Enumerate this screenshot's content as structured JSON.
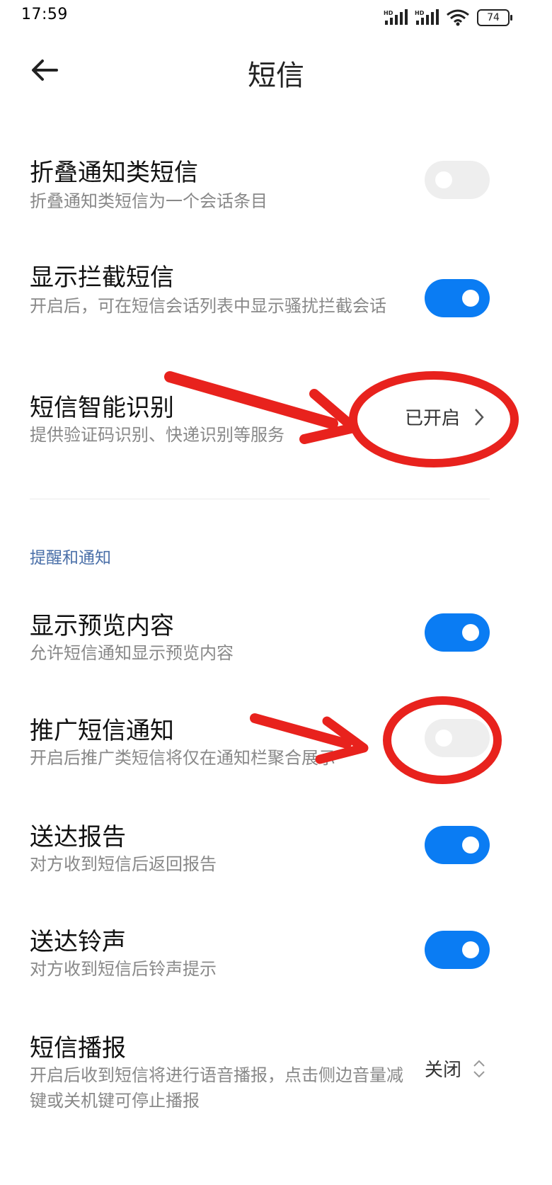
{
  "status": {
    "time": "17:59",
    "signal1": "HD",
    "signal2": "HD",
    "battery": "74"
  },
  "header": {
    "title": "短信"
  },
  "settings": [
    {
      "title": "折叠通知类短信",
      "subtitle": "折叠通知类短信为一个会话条目",
      "state": "off"
    },
    {
      "title": "显示拦截短信",
      "subtitle": "开启后，可在短信会话列表中显示骚扰拦截会话",
      "state": "on"
    },
    {
      "title": "短信智能识别",
      "subtitle": "提供验证码识别、快递识别等服务",
      "value": "已开启"
    }
  ],
  "section": {
    "label": "提醒和通知"
  },
  "notifications": [
    {
      "title": "显示预览内容",
      "subtitle": "允许短信通知显示预览内容",
      "state": "on"
    },
    {
      "title": "推广短信通知",
      "subtitle": "开启后推广类短信将仅在通知栏聚合展示",
      "state": "off"
    },
    {
      "title": "送达报告",
      "subtitle": "对方收到短信后返回报告",
      "state": "on"
    },
    {
      "title": "送达铃声",
      "subtitle": "对方收到短信后铃声提示",
      "state": "on"
    },
    {
      "title": "短信播报",
      "subtitle": "开启后收到短信将进行语音播报，点击侧边音量减键或关机键可停止播报",
      "value": "关闭"
    }
  ],
  "colors": {
    "accent": "#0a7cf3",
    "toggle_off": "#eeeeee",
    "annotation": "#e8221d",
    "section": "#4a6fa8"
  }
}
